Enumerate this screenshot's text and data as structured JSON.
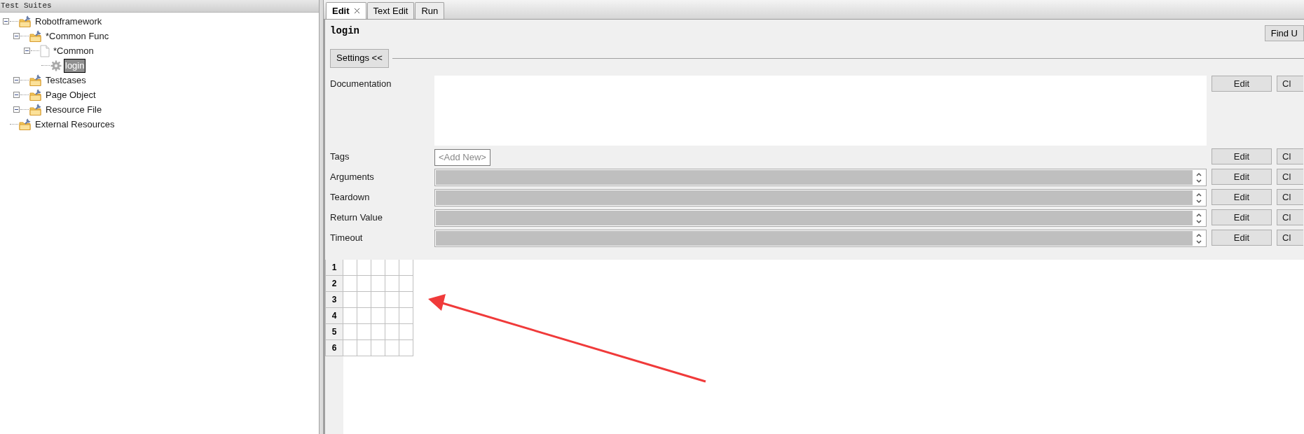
{
  "tree_panel": {
    "title": "Test Suites",
    "items": [
      {
        "label": "Robotframework",
        "kind": "suite",
        "expanded": true,
        "selected": false,
        "children": [
          {
            "label": "*Common Func",
            "kind": "suite",
            "expanded": true,
            "selected": false,
            "children": [
              {
                "label": "*Common",
                "kind": "resource",
                "expanded": true,
                "selected": false,
                "children": [
                  {
                    "label": "login",
                    "kind": "keyword",
                    "selected": true
                  }
                ]
              }
            ]
          },
          {
            "label": "Testcases",
            "kind": "suite",
            "expanded": true,
            "selected": false
          },
          {
            "label": "Page Object",
            "kind": "suite",
            "expanded": true,
            "selected": false
          },
          {
            "label": "Resource File",
            "kind": "suite",
            "expanded": true,
            "selected": false
          }
        ]
      },
      {
        "label": "External Resources",
        "kind": "suite",
        "selected": false
      }
    ]
  },
  "tabs": [
    {
      "label": "Edit",
      "selected": true,
      "closable": true
    },
    {
      "label": "Text Edit",
      "selected": false
    },
    {
      "label": "Run",
      "selected": false
    }
  ],
  "editor": {
    "title": "login",
    "find_button": "Find U",
    "settings_button": "Settings <<",
    "settings": [
      {
        "label": "Documentation",
        "kind": "text",
        "buttons": [
          "Edit",
          "Cl"
        ]
      },
      {
        "label": "Tags",
        "kind": "tags",
        "placeholder": "<Add New>",
        "buttons": [
          "Edit",
          "Cl"
        ]
      },
      {
        "label": "Arguments",
        "kind": "value",
        "buttons": [
          "Edit",
          "Cl"
        ]
      },
      {
        "label": "Teardown",
        "kind": "value",
        "buttons": [
          "Edit",
          "Cl"
        ]
      },
      {
        "label": "Return Value",
        "kind": "value",
        "buttons": [
          "Edit",
          "Cl"
        ]
      },
      {
        "label": "Timeout",
        "kind": "value",
        "buttons": [
          "Edit",
          "Cl"
        ]
      }
    ],
    "grid": {
      "row_numbers": [
        "1",
        "2",
        "3",
        "4",
        "5",
        "6"
      ]
    }
  }
}
